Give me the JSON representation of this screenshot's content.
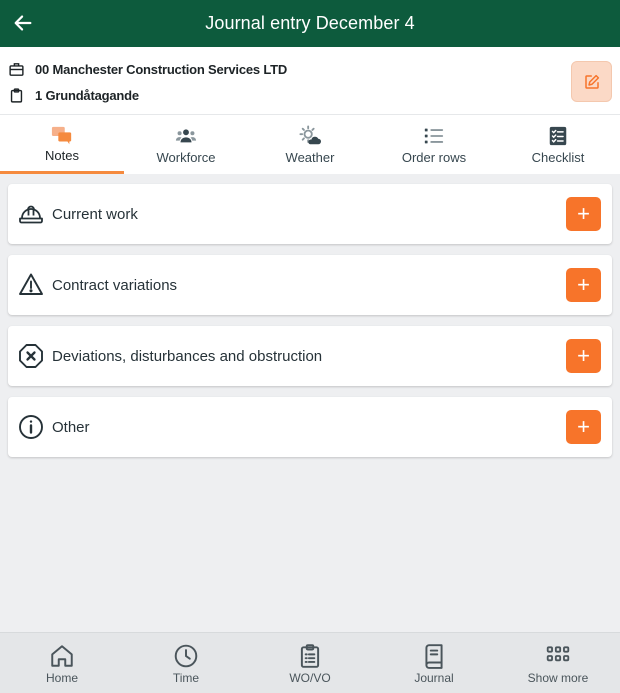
{
  "header": {
    "title": "Journal entry December 4"
  },
  "info": {
    "company": "00 Manchester Construction Services LTD",
    "project": "1 Grundåtagande"
  },
  "tabs": [
    {
      "label": "Notes",
      "icon": "chat-icon",
      "active": true
    },
    {
      "label": "Workforce",
      "icon": "people-icon"
    },
    {
      "label": "Weather",
      "icon": "weather-icon"
    },
    {
      "label": "Order rows",
      "icon": "list-icon"
    },
    {
      "label": "Checklist",
      "icon": "checklist-icon"
    }
  ],
  "sections": [
    {
      "label": "Current work",
      "icon": "hard-hat-icon",
      "action": "+"
    },
    {
      "label": "Contract variations",
      "icon": "warning-icon",
      "action": "+"
    },
    {
      "label": "Deviations, disturbances and obstruction",
      "icon": "octagon-x-icon",
      "action": "+"
    },
    {
      "label": "Other",
      "icon": "info-icon",
      "action": "+"
    }
  ],
  "bottom_nav": [
    {
      "label": "Home",
      "icon": "home-icon"
    },
    {
      "label": "Time",
      "icon": "clock-icon"
    },
    {
      "label": "WO/VO",
      "icon": "clipboard-icon"
    },
    {
      "label": "Journal",
      "icon": "book-icon"
    },
    {
      "label": "Show more",
      "icon": "grid-icon"
    }
  ],
  "colors": {
    "header_bg": "#0d5b3d",
    "accent": "#f7742a",
    "edit_bg": "#fbd9c6",
    "page_bg": "#eeeff1"
  }
}
